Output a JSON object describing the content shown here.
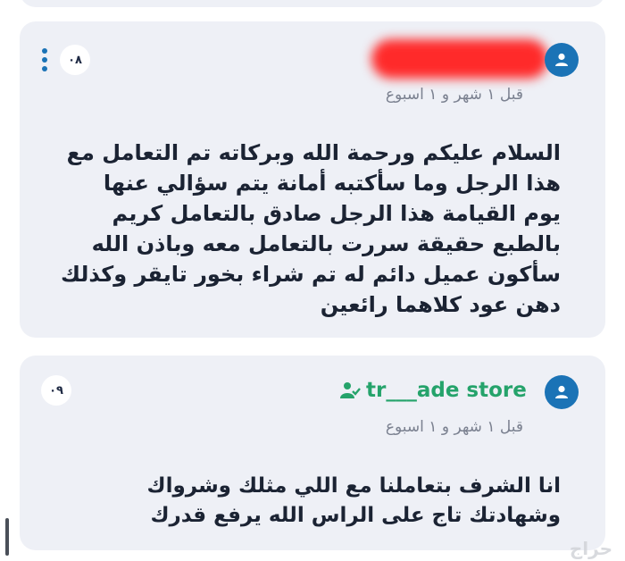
{
  "comment1": {
    "badge": "٠٨",
    "time": "قبل ١ شهر و ١ اسبوع",
    "text": "السلام عليكم ورحمة الله وبركاته تم التعامل مع هذا الرجل وما سأكتبه أمانة يتم سؤالي عنها يوم القيامة هذا الرجل صادق بالتعامل كريم بالطبع حقيقة سررت بالتعامل معه وباذن الله سأكون عميل دائم له تم شراء بخور تايقر وكذلك دهن عود كلاهما رائعين"
  },
  "comment2": {
    "badge": "٠٩",
    "author": "tr___ade store",
    "time": "قبل ١ شهر و ١ اسبوع",
    "text": "انا الشرف بتعاملنا مع اللي مثلك وشرواك وشهادتك تاج على الراس الله يرفع قدرك"
  },
  "watermark": "حراج",
  "colors": {
    "accent": "#1b73b6",
    "seller": "#25a36b",
    "card_bg": "#eef0f6"
  }
}
